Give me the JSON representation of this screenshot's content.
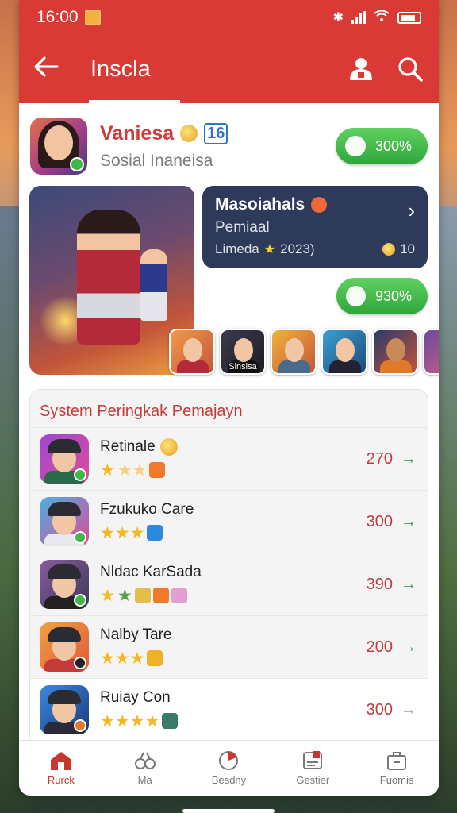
{
  "status_bar": {
    "time": "16:00"
  },
  "app_bar": {
    "title": "Inscla"
  },
  "profile": {
    "name": "Vaniesa",
    "level": "16",
    "subtitle": "Sosial Inaneisa",
    "pill_value": "300%"
  },
  "featured": {
    "title": "Masoiahals",
    "subtitle": "Pemiaal",
    "meta": "Limeda",
    "year": "2023)",
    "count": "10",
    "pill_value": "930%"
  },
  "thumbnails": [
    {
      "label": ""
    },
    {
      "label": "Sinsisa"
    },
    {
      "label": ""
    },
    {
      "label": ""
    },
    {
      "label": ""
    },
    {
      "label": ""
    }
  ],
  "ranking": {
    "title": "System Peringkak Pemajayn",
    "rows": [
      {
        "name": "Retinale",
        "score": "270"
      },
      {
        "name": "Fzukuko Care",
        "score": "300"
      },
      {
        "name": "Nldac KarSada",
        "score": "390"
      },
      {
        "name": "Nalby Tare",
        "score": "200"
      },
      {
        "name": "Ruiay Con",
        "score": "300"
      }
    ]
  },
  "bottom_nav": [
    {
      "label": "Rurck",
      "icon": "home-icon"
    },
    {
      "label": "Ma",
      "icon": "link-icon"
    },
    {
      "label": "Besdny",
      "icon": "chart-icon"
    },
    {
      "label": "Gestier",
      "icon": "card-icon"
    },
    {
      "label": "Fuomis",
      "icon": "bag-icon"
    }
  ],
  "colors": {
    "accent": "#d93a36",
    "green": "#3cb843",
    "dark_card": "#2d3a5a"
  }
}
